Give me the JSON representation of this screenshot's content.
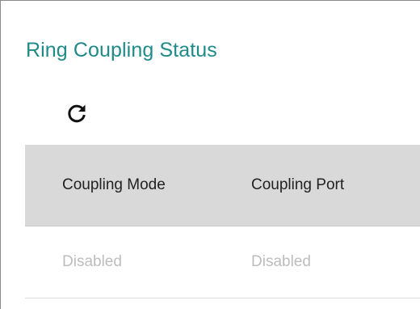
{
  "panel": {
    "title": "Ring Coupling Status"
  },
  "toolbar": {
    "refresh_icon": "refresh-icon"
  },
  "table": {
    "columns": [
      "Coupling Mode",
      "Coupling Port"
    ],
    "rows": [
      [
        "Disabled",
        "Disabled"
      ]
    ]
  },
  "colors": {
    "title": "#1f8a8a",
    "header_bg": "#d9d9d9",
    "cell_text": "#bdbdbd",
    "header_text": "#222222"
  }
}
